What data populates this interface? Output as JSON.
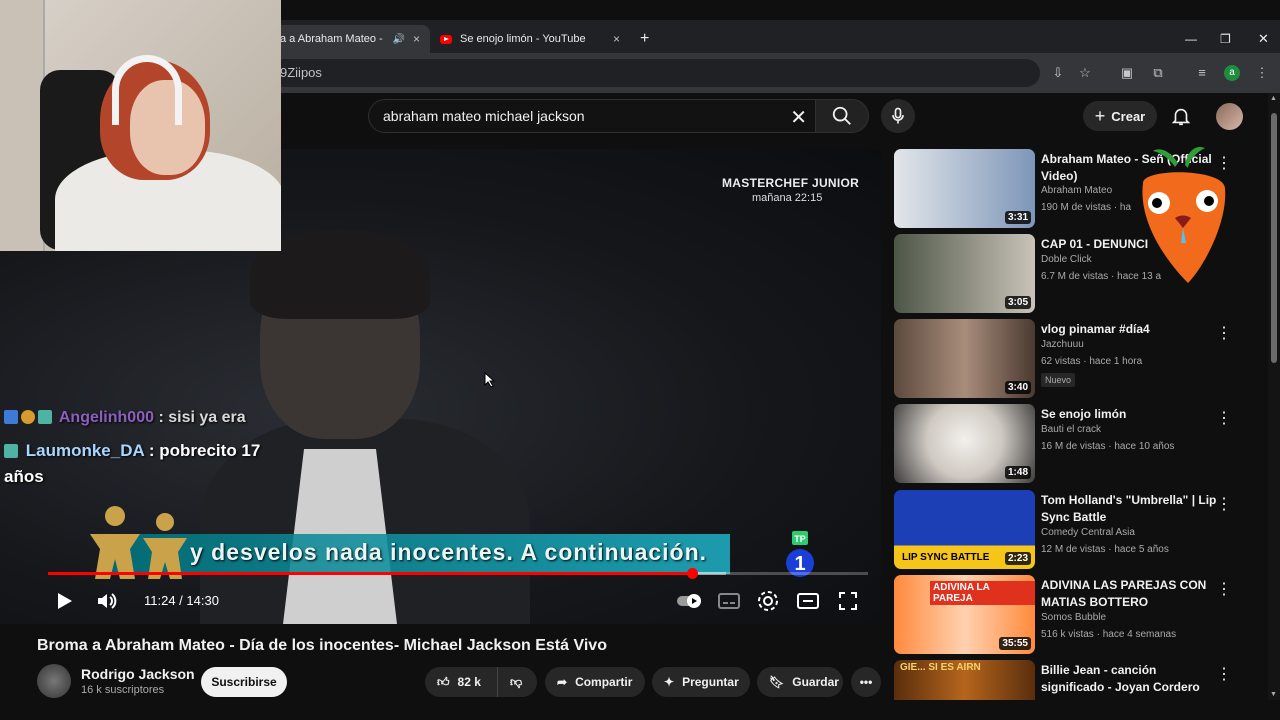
{
  "browser": {
    "tabs": [
      {
        "label": "a a Abraham Mateo -",
        "close": "×"
      },
      {
        "label": "Se enojo limón - YouTube",
        "close": "×"
      }
    ],
    "new_tab": "+",
    "url": "9Ziipos"
  },
  "header": {
    "search_query": "abraham mateo michael jackson",
    "clear": "✕",
    "create_label": "Crear"
  },
  "player": {
    "watermark_title": "MASTERCHEF JUNIOR",
    "watermark_time": "mañana 22:15",
    "subtitle": "y desvelos nada inocentes. A continuación.",
    "time": "11:24 / 14:30",
    "progress": 0.7852
  },
  "chat": [
    {
      "user": "Angelinh000",
      "message": ": sisi ya era",
      "color": "#8c5fbf"
    },
    {
      "user": "Laumonke_DA",
      "message": ": pobrecito 17",
      "color": "#a9d6ff"
    },
    {
      "continuation": "años"
    }
  ],
  "video": {
    "title": "Broma a Abraham Mateo - Día de los inocentes- Michael Jackson Está Vivo",
    "channel": "Rodrigo Jackson",
    "subscribers": "16 k suscriptores",
    "subscribe_label": "Suscribirse",
    "likes": "82 k",
    "share_label": "Compartir",
    "ask_label": "Preguntar",
    "save_label": "Guardar"
  },
  "sidebar": [
    {
      "title": "Abraham Mateo - Señ (Official Video)",
      "channel": "Abraham Mateo",
      "meta": "190 M de vistas · ha",
      "duration": "3:31",
      "thumb": "#3d6fa3"
    },
    {
      "title": "CAP 01 - DENUNCI",
      "channel": "Doble Click",
      "meta": "6.7 M de vistas · hace 13 a",
      "duration": "3:05",
      "thumb": "#5e6a55"
    },
    {
      "title": "vlog pinamar #día4",
      "channel": "Jazchuuu",
      "meta": "62 vistas · hace 1 hora",
      "badge": "Nuevo",
      "duration": "3:40",
      "thumb": "#6d5a4a"
    },
    {
      "title": "Se enojo limón",
      "channel": "Bauti el crack",
      "meta": "16 M de vistas · hace 10 años",
      "duration": "1:48",
      "thumb": "#d7d2cc"
    },
    {
      "title": "Tom Holland's \"Umbrella\" | Lip Sync Battle",
      "channel": "Comedy Central Asia",
      "meta": "12 M de vistas · hace 5 años",
      "duration": "2:23",
      "overlay": "LIP SYNC BATTLE",
      "thumb": "#1a3aa8"
    },
    {
      "title": "ADIVINA LAS PAREJAS CON MATIAS BOTTERO",
      "channel": "Somos Bubble",
      "meta": "516 k vistas · hace 4 semanas",
      "duration": "35:55",
      "overlay": "ADIVINA LA PAREJA",
      "thumb": "#ff7a3d"
    },
    {
      "title": "Billie Jean - canción significado - Joyan Cordero",
      "channel": "",
      "meta": "",
      "overlay": "GIE... SI ES AIRN",
      "thumb": "#6b3a10"
    }
  ]
}
